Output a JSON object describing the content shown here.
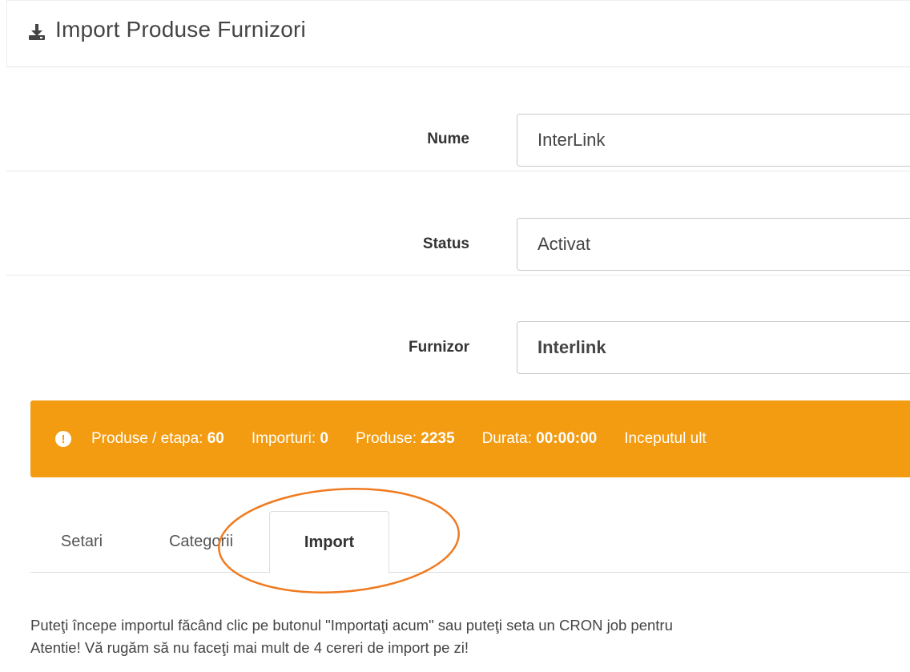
{
  "header": {
    "title": "Import Produse Furnizori",
    "icon": "download-icon"
  },
  "form": {
    "nume": {
      "label": "Nume",
      "value": "InterLink"
    },
    "status": {
      "label": "Status",
      "value": "Activat"
    },
    "furnizor": {
      "label": "Furnizor",
      "value": "Interlink"
    }
  },
  "alert": {
    "color": "#f39c12",
    "icon": "exclamation-circle-icon",
    "items": [
      {
        "label": "Produse / etapa:",
        "value": "60"
      },
      {
        "label": "Importuri:",
        "value": "0"
      },
      {
        "label": "Produse:",
        "value": "2235"
      },
      {
        "label": "Durata:",
        "value": "00:00:00"
      },
      {
        "label": "Inceputul ult",
        "value": ""
      }
    ]
  },
  "tabs": [
    {
      "label": "Setari"
    },
    {
      "label": "Categorii"
    },
    {
      "label": "Import",
      "active": true
    }
  ],
  "annotation_color": "#f07a1f",
  "message": {
    "line1": "Puteţi începe importul făcând clic pe butonul \"Importaţi acum\" sau puteţi seta un CRON job pentru",
    "line2": "Atentie! Vă rugăm să nu faceţi mai mult de 4 cereri de import pe zi!"
  }
}
